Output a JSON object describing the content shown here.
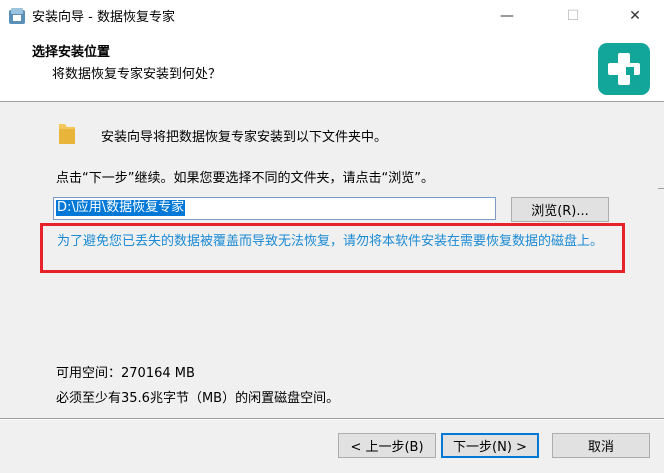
{
  "window": {
    "title": "安装向导 - 数据恢复专家",
    "min_glyph": "—",
    "max_glyph": "☐",
    "close_glyph": "✕"
  },
  "header": {
    "title": "选择安装位置",
    "subtitle": "将数据恢复专家安装到何处？",
    "logo_icon": "medical-cross-icon",
    "logo_color": "#12a59a"
  },
  "body": {
    "intro": "安装向导将把数据恢复专家安装到以下文件夹中。",
    "continue_hint": "点击“下一步”继续。如果您要选择不同的文件夹，请点击“浏览”。",
    "path_value": "D:\\应用\\数据恢复专家",
    "browse_label": "浏览(R)...",
    "warning": "为了避免您已丢失的数据被覆盖而导致无法恢复，请勿将本软件安装在需要恢复数据的磁盘上。",
    "warning_color": "#1a8ad4",
    "highlight_color": "#e8222a",
    "available_space": "可用空间：270164 MB",
    "required_space": "必须至少有35.6兆字节（MB）的闲置磁盘空间。"
  },
  "footer": {
    "back_label": "< 上一步(B)",
    "next_label": "下一步(N) >",
    "cancel_label": "取消"
  }
}
